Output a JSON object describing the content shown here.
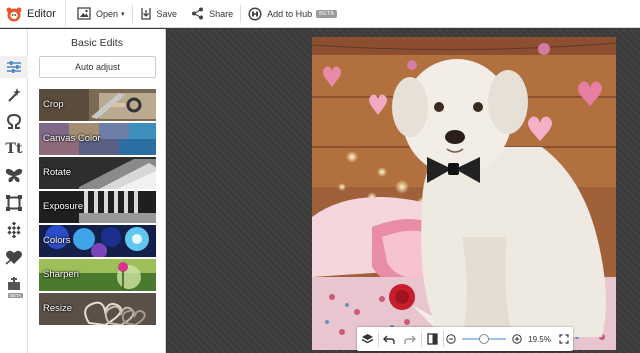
{
  "app": {
    "name": "Editor",
    "logo_icon": "picmonkey-logo-icon",
    "brand_color": "#e8562a"
  },
  "topbar": {
    "open_label": "Open",
    "save_label": "Save",
    "share_label": "Share",
    "hub_label": "Add to Hub",
    "hub_badge": "BETA"
  },
  "rail": {
    "items": [
      {
        "name": "basic-edits-icon",
        "active": true
      },
      {
        "name": "magic-wand-icon"
      },
      {
        "name": "touch-up-icon"
      },
      {
        "name": "text-tool-icon",
        "text": "Tt"
      },
      {
        "name": "graphics-butterfly-icon"
      },
      {
        "name": "frames-icon"
      },
      {
        "name": "textures-icon"
      },
      {
        "name": "themes-heart-icon"
      },
      {
        "name": "beta-tool-icon",
        "badge": "BETA"
      }
    ]
  },
  "panel": {
    "title": "Basic Edits",
    "auto_adjust_label": "Auto adjust",
    "tools": [
      {
        "label": "Crop"
      },
      {
        "label": "Canvas Color"
      },
      {
        "label": "Rotate"
      },
      {
        "label": "Exposure"
      },
      {
        "label": "Colors"
      },
      {
        "label": "Sharpen"
      },
      {
        "label": "Resize"
      }
    ]
  },
  "bottombar": {
    "zoom_value": "19.5%",
    "zoom_level": 0.46,
    "icons": [
      "layers-icon",
      "undo-icon",
      "redo-icon",
      "compare-icon",
      "zoom-out-icon",
      "zoom-in-icon",
      "fullscreen-icon"
    ]
  }
}
